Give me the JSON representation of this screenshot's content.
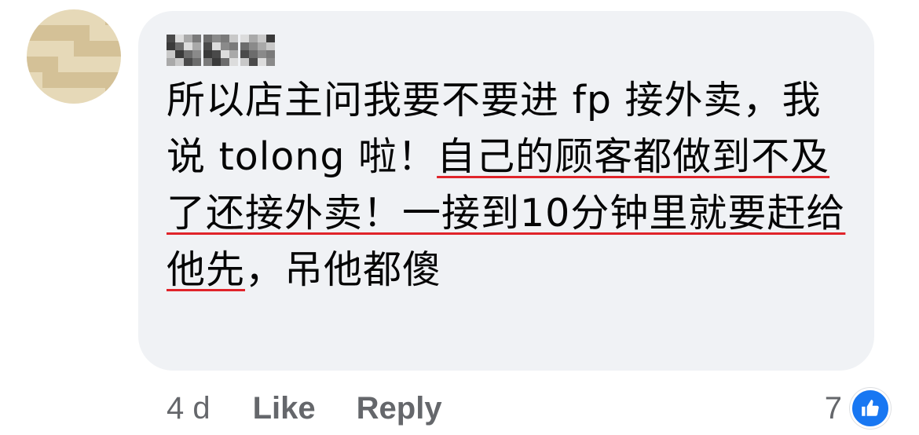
{
  "comment": {
    "segments": [
      {
        "text": "所以店主问我要不要进 fp 接外卖，我说 tolong 啦！",
        "highlight": false
      },
      {
        "text": "自己的顾客都做到不及了还接外卖！一接到10分钟里就要赶给他先",
        "highlight": true
      },
      {
        "text": "，吊他都傻",
        "highlight": false
      }
    ]
  },
  "meta": {
    "time": "4 d",
    "like_label": "Like",
    "reply_label": "Reply"
  },
  "reactions": {
    "count": "7",
    "icon": "thumbs-up-icon",
    "badge_color": "#1877f2"
  },
  "colors": {
    "bubble": "#f0f2f5",
    "underline": "#e0242a",
    "meta_text": "#65676b"
  }
}
